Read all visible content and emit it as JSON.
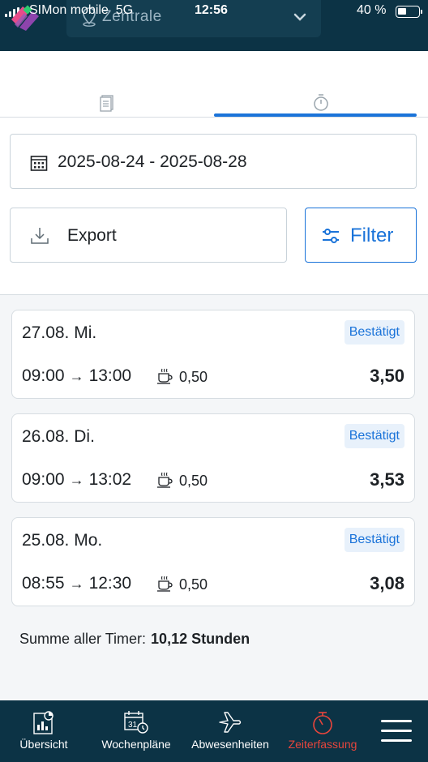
{
  "status_bar": {
    "carrier": "SIMon mobile",
    "network": "5G",
    "time": "12:56",
    "battery": "40 %",
    "battery_level": 0.4
  },
  "header": {
    "location": "Zentrale",
    "logo_icon": "app-logo-icon"
  },
  "tabs": [
    {
      "icon": "document-list-icon",
      "active": false
    },
    {
      "icon": "stopwatch-icon",
      "active": true
    }
  ],
  "filters": {
    "date_range": "2025-08-24 - 2025-08-28",
    "export_label": "Export",
    "filter_label": "Filter"
  },
  "entries": [
    {
      "date": "27.08.",
      "weekday": "Mi.",
      "status": "Bestätigt",
      "start": "09:00",
      "end": "13:00",
      "break": "0,50",
      "total": "3,50"
    },
    {
      "date": "26.08.",
      "weekday": "Di.",
      "status": "Bestätigt",
      "start": "09:00",
      "end": "13:02",
      "break": "0,50",
      "total": "3,53"
    },
    {
      "date": "25.08.",
      "weekday": "Mo.",
      "status": "Bestätigt",
      "start": "08:55",
      "end": "12:30",
      "break": "0,50",
      "total": "3,08"
    }
  ],
  "summary": {
    "label": "Summe aller Timer:",
    "value": "10,12 Stunden"
  },
  "bottom_nav": [
    {
      "label": "Übersicht",
      "icon": "overview-chart-icon",
      "active": false
    },
    {
      "label": "Wochenpläne",
      "icon": "calendar-clock-icon",
      "active": false
    },
    {
      "label": "Abwesenheiten",
      "icon": "airplane-icon",
      "active": false
    },
    {
      "label": "Zeiterfassung",
      "icon": "stopwatch-icon",
      "active": true
    }
  ],
  "colors": {
    "header_bg": "#0c3345",
    "accent": "#1a73d9",
    "active_nav": "#e8453c",
    "badge_bg": "#e8f1fb"
  }
}
